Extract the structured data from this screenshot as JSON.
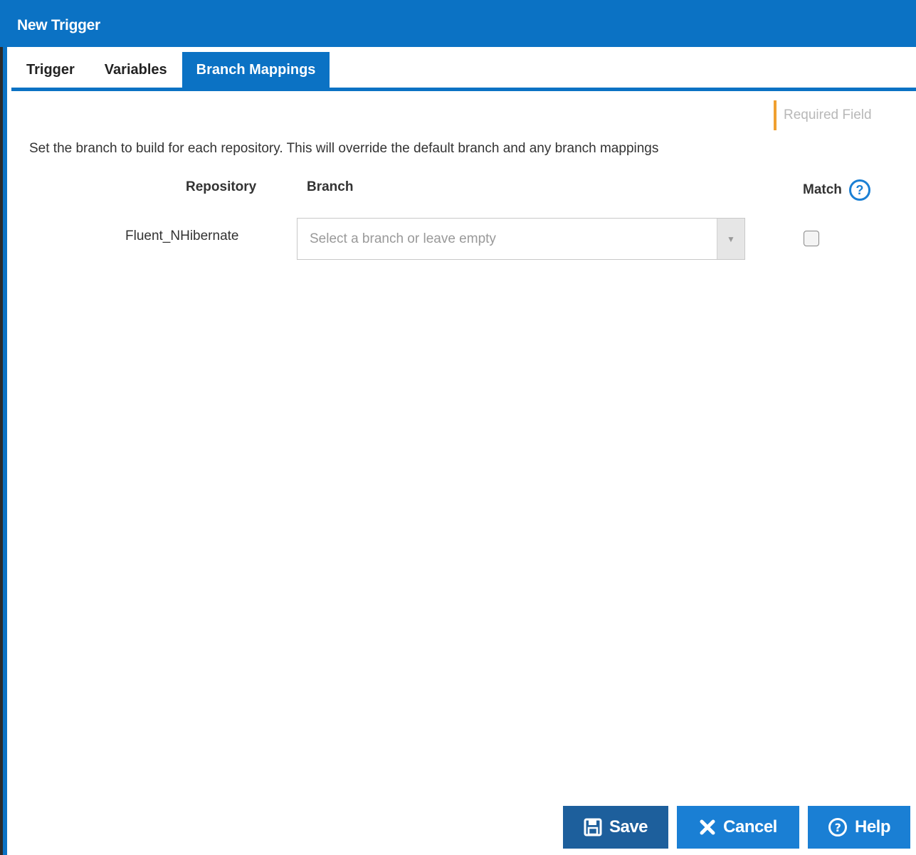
{
  "window": {
    "title": "New Trigger"
  },
  "tabs": [
    {
      "label": "Trigger",
      "active": false
    },
    {
      "label": "Variables",
      "active": false
    },
    {
      "label": "Branch Mappings",
      "active": true
    }
  ],
  "legend": {
    "required_label": "Required Field",
    "marker_color": "#f0a030"
  },
  "description": "Set the branch to build for each repository. This will override the default branch and any branch mappings",
  "table": {
    "headers": {
      "repository": "Repository",
      "branch": "Branch",
      "match": "Match"
    },
    "rows": [
      {
        "repository": "Fluent_NHibernate",
        "branch_placeholder": "Select a branch or leave empty",
        "match": false
      }
    ]
  },
  "icons": {
    "match_help": "question-circle-icon",
    "select_arrow": "caret-down-icon",
    "save": "floppy-disk-icon",
    "cancel": "x-icon",
    "help": "question-circle-icon"
  },
  "buttons": {
    "save": "Save",
    "cancel": "Cancel",
    "help": "Help"
  },
  "colors": {
    "primary": "#0b72c4",
    "save_button": "#1d5f9c",
    "button": "#1a7fd4"
  }
}
